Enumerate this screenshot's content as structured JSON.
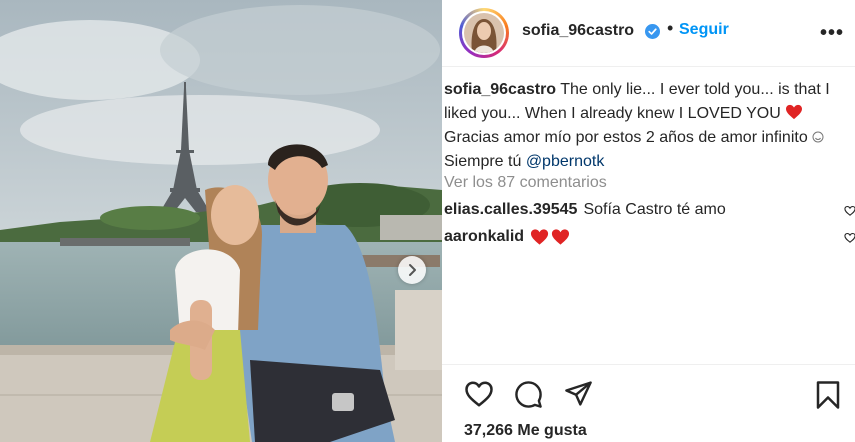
{
  "post": {
    "username": "sofia_96castro",
    "follow_label": "Seguir",
    "more_label": "•••",
    "caption_line1": "The only lie... I ever told you... is that I",
    "caption_line2": "liked you... When I already knew I LOVED YOU",
    "caption_line3": "Gracias amor mío por estos 2 años de amor infinito",
    "caption_line4_prefix": "Siempre tú ",
    "caption_mention": "@pbernotk",
    "view_comments": "Ver los 87 comentarios",
    "likes": "37,266 Me gusta"
  },
  "comments": [
    {
      "username": "elias.calles.39545",
      "text": "Sofía Castro té amo"
    },
    {
      "username": "aaronkalid",
      "text": ""
    }
  ],
  "icons": {
    "verified": "verified-badge-icon",
    "heart_emoji": "red-heart-emoji",
    "like": "heart-outline-icon",
    "comment": "comment-bubble-icon",
    "share": "paper-plane-icon",
    "save": "bookmark-icon",
    "next": "chevron-right-icon"
  },
  "colors": {
    "accent": "#0095f6",
    "text": "#262626",
    "muted": "#8e8e8e",
    "verified": "#3897f0",
    "heart": "#ed4956"
  }
}
